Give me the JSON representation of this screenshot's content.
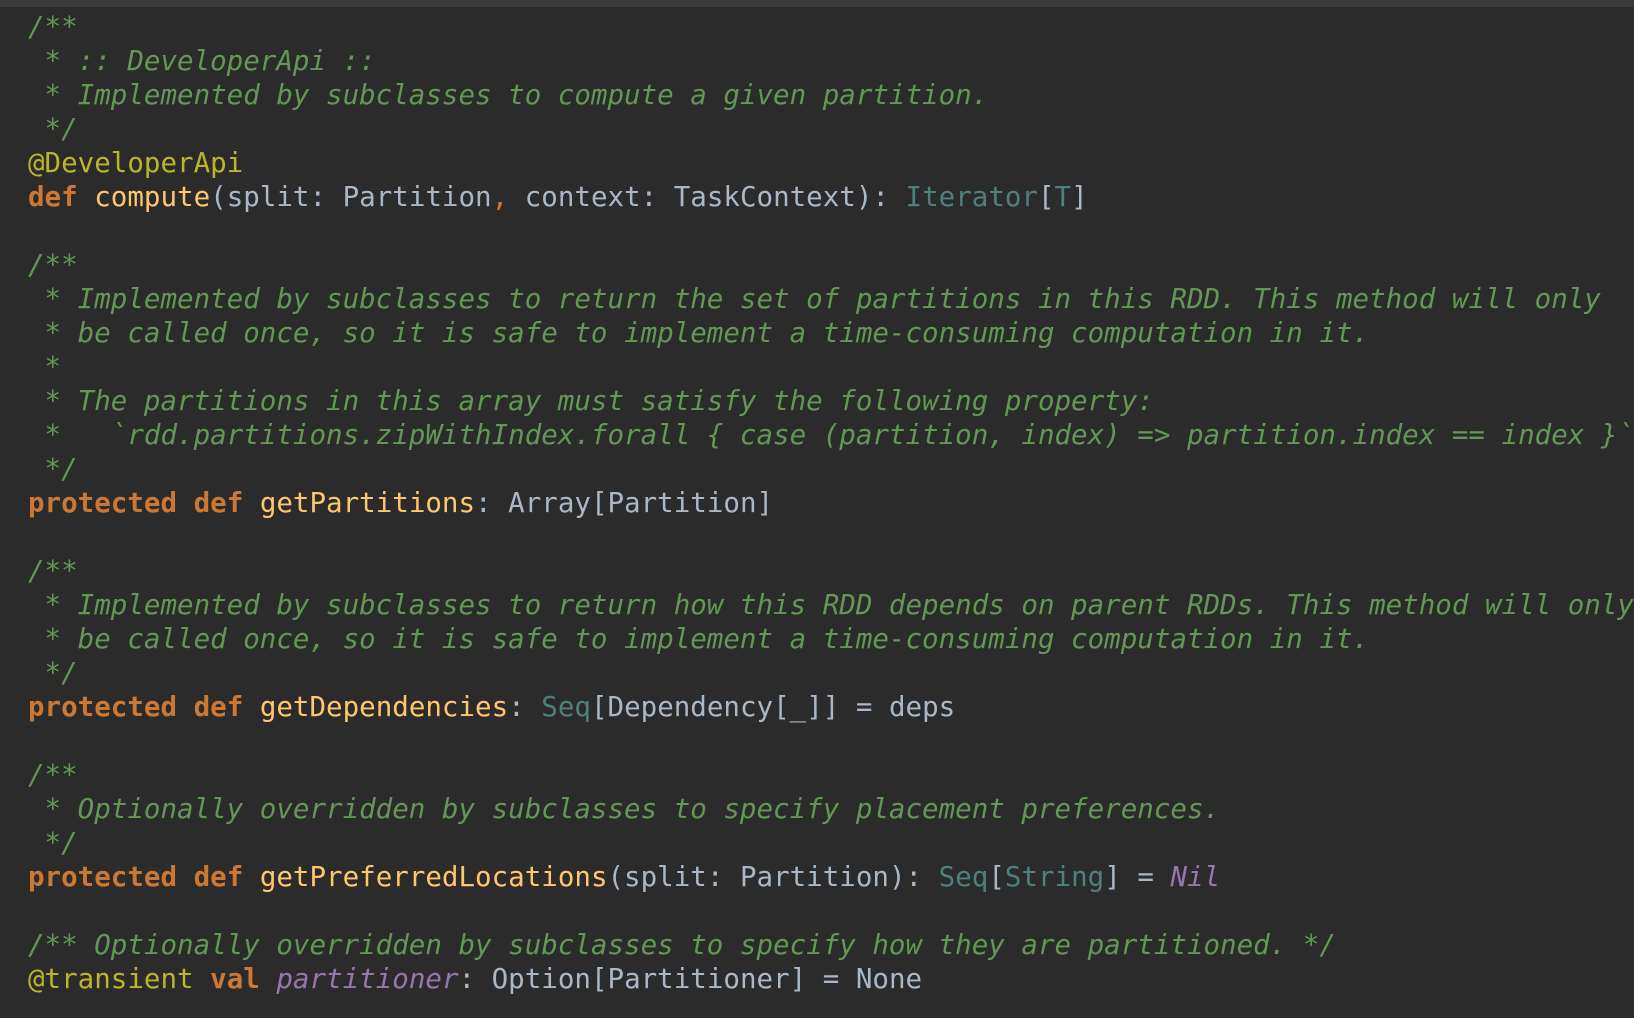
{
  "lines": [
    [
      {
        "t": "/**",
        "c": "cm"
      }
    ],
    [
      {
        "t": " * :: DeveloperApi ::",
        "c": "cm"
      }
    ],
    [
      {
        "t": " * Implemented by subclasses to compute a given partition.",
        "c": "cm"
      }
    ],
    [
      {
        "t": " */",
        "c": "cm"
      }
    ],
    [
      {
        "t": "@DeveloperApi",
        "c": "ann"
      }
    ],
    [
      {
        "t": "def",
        "c": "kw"
      },
      {
        "t": " ",
        "c": "pu"
      },
      {
        "t": "compute",
        "c": "fn"
      },
      {
        "t": "(split: Partition",
        "c": "pu"
      },
      {
        "t": ",",
        "c": "cma"
      },
      {
        "t": " context: TaskContext): ",
        "c": "pu"
      },
      {
        "t": "Iterator",
        "c": "ty"
      },
      {
        "t": "[",
        "c": "pu"
      },
      {
        "t": "T",
        "c": "tp"
      },
      {
        "t": "]",
        "c": "pu"
      }
    ],
    [],
    [
      {
        "t": "/**",
        "c": "cm"
      }
    ],
    [
      {
        "t": " * Implemented by subclasses to return the set of partitions in this RDD. This method will only",
        "c": "cm"
      }
    ],
    [
      {
        "t": " * be called once, so it is safe to implement a time-consuming computation in it.",
        "c": "cm"
      }
    ],
    [
      {
        "t": " *",
        "c": "cm"
      }
    ],
    [
      {
        "t": " * The partitions in this array must satisfy the following property:",
        "c": "cm"
      }
    ],
    [
      {
        "t": " *   `rdd.partitions.zipWithIndex.forall { case (partition, index) => partition.index == index }`",
        "c": "cm"
      }
    ],
    [
      {
        "t": " */",
        "c": "cm"
      }
    ],
    [
      {
        "t": "protected",
        "c": "kw"
      },
      {
        "t": " ",
        "c": "pu"
      },
      {
        "t": "def",
        "c": "kw"
      },
      {
        "t": " ",
        "c": "pu"
      },
      {
        "t": "getPartitions",
        "c": "fn"
      },
      {
        "t": ": Array[Partition]",
        "c": "pu"
      }
    ],
    [],
    [
      {
        "t": "/**",
        "c": "cm"
      }
    ],
    [
      {
        "t": " * Implemented by subclasses to return how this RDD depends on parent RDDs. This method will only",
        "c": "cm"
      }
    ],
    [
      {
        "t": " * be called once, so it is safe to implement a time-consuming computation in it.",
        "c": "cm"
      }
    ],
    [
      {
        "t": " */",
        "c": "cm"
      }
    ],
    [
      {
        "t": "protected",
        "c": "kw"
      },
      {
        "t": " ",
        "c": "pu"
      },
      {
        "t": "def",
        "c": "kw"
      },
      {
        "t": " ",
        "c": "pu"
      },
      {
        "t": "getDependencies",
        "c": "fn"
      },
      {
        "t": ": ",
        "c": "pu"
      },
      {
        "t": "Seq",
        "c": "ty"
      },
      {
        "t": "[Dependency[_]] = deps",
        "c": "pu"
      }
    ],
    [],
    [
      {
        "t": "/**",
        "c": "cm"
      }
    ],
    [
      {
        "t": " * Optionally overridden by subclasses to specify placement preferences.",
        "c": "cm"
      }
    ],
    [
      {
        "t": " */",
        "c": "cm"
      }
    ],
    [
      {
        "t": "protected",
        "c": "kw"
      },
      {
        "t": " ",
        "c": "pu"
      },
      {
        "t": "def",
        "c": "kw"
      },
      {
        "t": " ",
        "c": "pu"
      },
      {
        "t": "getPreferredLocations",
        "c": "fn"
      },
      {
        "t": "(split: Partition): ",
        "c": "pu"
      },
      {
        "t": "Seq",
        "c": "ty"
      },
      {
        "t": "[",
        "c": "pu"
      },
      {
        "t": "String",
        "c": "ty"
      },
      {
        "t": "] = ",
        "c": "pu"
      },
      {
        "t": "Nil",
        "c": "it"
      }
    ],
    [],
    [
      {
        "t": "/** Optionally overridden by subclasses to specify how they are partitioned. */",
        "c": "cm"
      }
    ],
    [
      {
        "t": "@transient",
        "c": "ann"
      },
      {
        "t": " ",
        "c": "pu"
      },
      {
        "t": "val",
        "c": "kw"
      },
      {
        "t": " ",
        "c": "pu"
      },
      {
        "t": "partitioner",
        "c": "it"
      },
      {
        "t": ": Option[Partitioner] = None",
        "c": "pu"
      }
    ]
  ],
  "colors": {
    "background": "#2b2b2b",
    "comment": "#629755",
    "keyword": "#cc7832",
    "function": "#ffc66d",
    "annotation": "#bbb529",
    "type": "#4e807d",
    "identifier": "#a9b7c6",
    "italic_member": "#9876aa"
  }
}
